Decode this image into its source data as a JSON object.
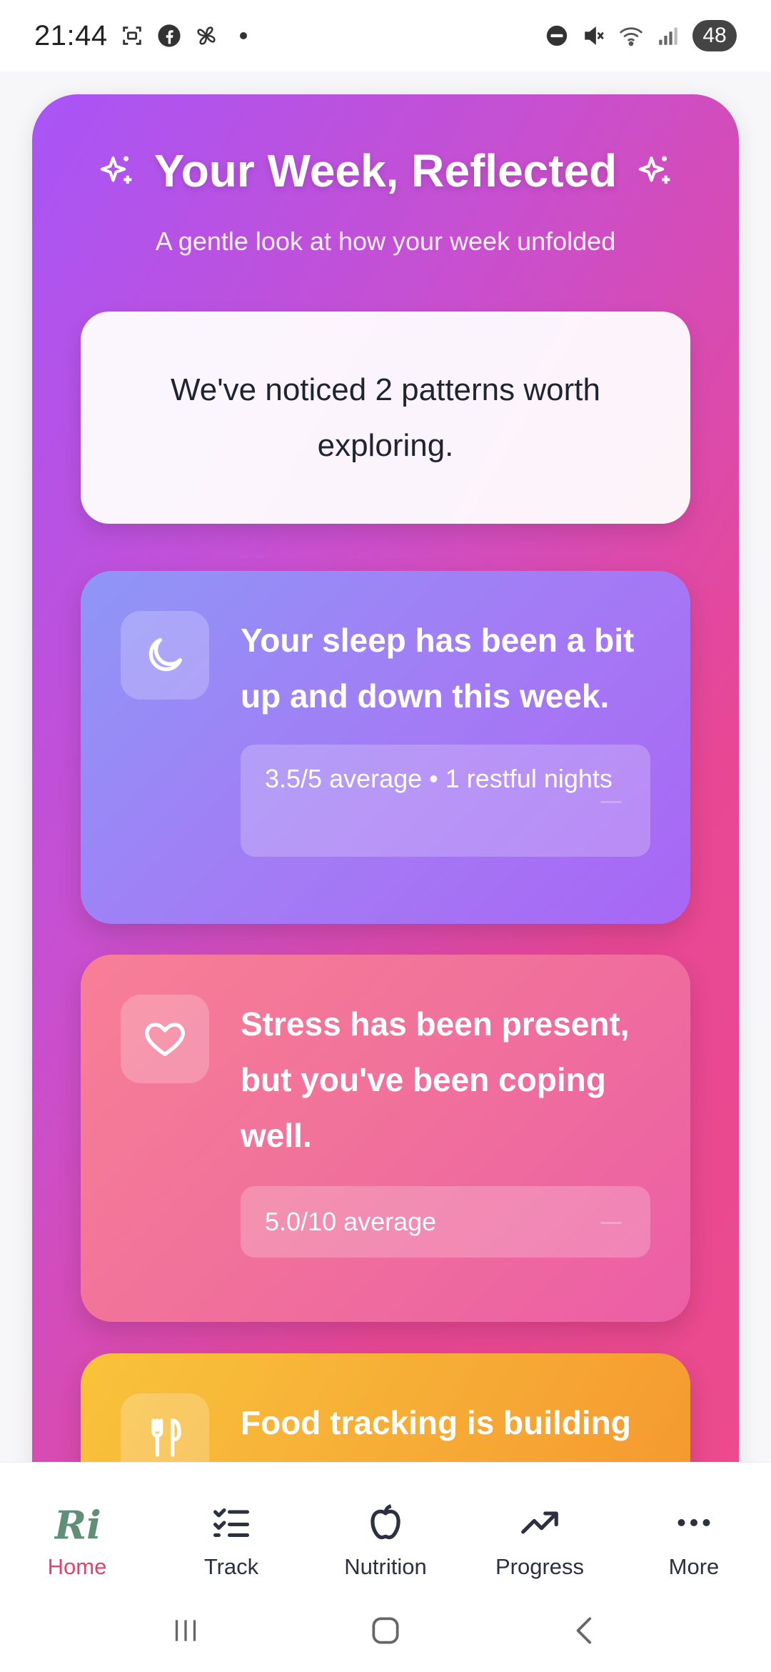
{
  "status_bar": {
    "time": "21:44",
    "battery": "48",
    "icons": [
      "screenshot-icon",
      "facebook-icon",
      "pinwheel-icon",
      "dot-icon",
      "do-not-disturb-icon",
      "mute-icon",
      "wifi-icon",
      "signal-icon",
      "battery-icon"
    ]
  },
  "hero": {
    "title": "Your Week, Reflected",
    "subtitle": "A gentle look at how your week unfolded",
    "summary": "We've noticed 2 patterns worth exploring."
  },
  "cards": [
    {
      "icon": "moon-icon",
      "text": "Your sleep has been a bit up and down this week.",
      "stat": "3.5/5 average • 1 restful nights",
      "color": "#a47af5"
    },
    {
      "icon": "heart-icon",
      "text": "Stress has been present, but you've been coping well.",
      "stat": "5.0/10 average",
      "color": "#f0709b"
    },
    {
      "icon": "fork-knife-icon",
      "text": "Food tracking is building",
      "color": "#f6ad36"
    }
  ],
  "bottom_nav": {
    "items": [
      {
        "label": "Home",
        "icon": "app-logo-icon",
        "active": true
      },
      {
        "label": "Track",
        "icon": "checklist-icon",
        "active": false
      },
      {
        "label": "Nutrition",
        "icon": "apple-icon",
        "active": false
      },
      {
        "label": "Progress",
        "icon": "trending-up-icon",
        "active": false
      },
      {
        "label": "More",
        "icon": "more-dots-icon",
        "active": false
      }
    ],
    "active_color": "#e0446c"
  },
  "system_nav": [
    "recents-button",
    "home-button",
    "back-button"
  ]
}
